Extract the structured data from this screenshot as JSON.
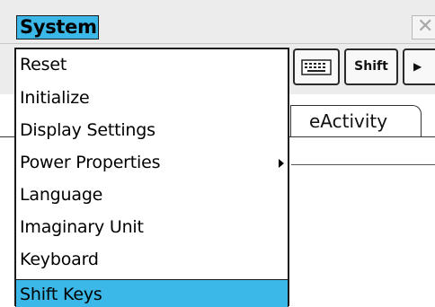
{
  "title_bar": {
    "system_menu_label": "System",
    "close_glyph": "✕"
  },
  "toolbar": {
    "keyboard_icon": "keyboard-icon",
    "shift_label": "Shift",
    "more_glyph": "▶"
  },
  "tabs": {
    "active_label": "eActivity"
  },
  "system_menu": {
    "items": [
      {
        "label": "Reset",
        "submenu": false,
        "selected": false
      },
      {
        "label": "Initialize",
        "submenu": false,
        "selected": false
      },
      {
        "label": "Display Settings",
        "submenu": false,
        "selected": false
      },
      {
        "label": "Power Properties",
        "submenu": true,
        "selected": false
      },
      {
        "label": "Language",
        "submenu": false,
        "selected": false
      },
      {
        "label": "Imaginary Unit",
        "submenu": false,
        "selected": false
      },
      {
        "label": "Keyboard",
        "submenu": false,
        "selected": false
      },
      {
        "label": "Shift Keys",
        "submenu": false,
        "selected": true
      }
    ]
  },
  "colors": {
    "highlight": "#3cb8e8",
    "border": "#1a1a1a",
    "chrome": "#ececec"
  }
}
